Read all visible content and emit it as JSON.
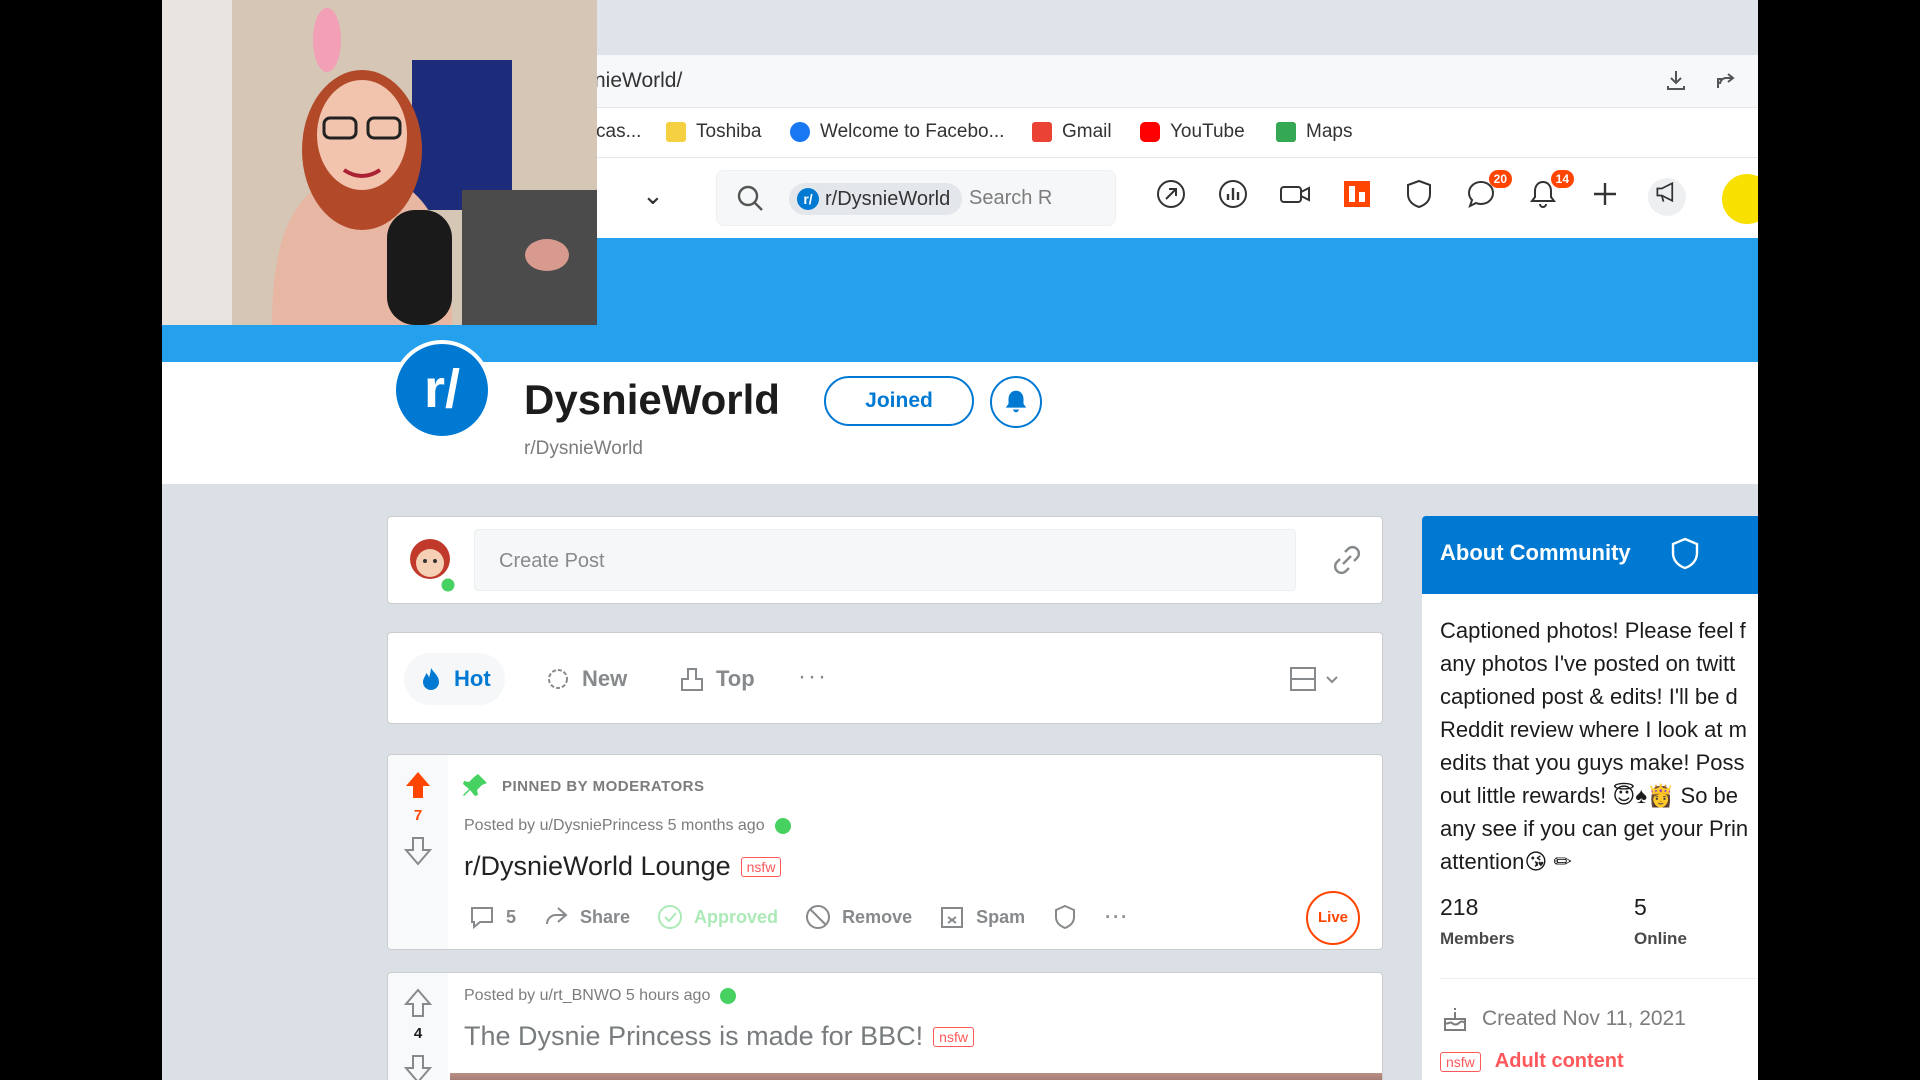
{
  "browser": {
    "url": "nieWorld/",
    "bookmarks": [
      {
        "label": "cas...",
        "color": "#8a8a8a"
      },
      {
        "label": "Toshiba",
        "color": "#f5d142"
      },
      {
        "label": "Welcome to Facebo...",
        "color": "#1877f2"
      },
      {
        "label": "Gmail",
        "color": "#ea4335"
      },
      {
        "label": "YouTube",
        "color": "#ff0000"
      },
      {
        "label": "Maps",
        "color": "#34a853"
      }
    ]
  },
  "header": {
    "search_chip": "r/DysnieWorld",
    "search_placeholder": "Search R",
    "chat_badge": "20",
    "notif_badge": "14"
  },
  "community": {
    "title": "DysnieWorld",
    "name": "r/DysnieWorld",
    "logo_text": "r/",
    "joined_label": "Joined"
  },
  "create_post": {
    "placeholder": "Create Post"
  },
  "sort": {
    "hot": "Hot",
    "new": "New",
    "top": "Top",
    "more": "···"
  },
  "posts": [
    {
      "pinned_label": "PINNED BY MODERATORS",
      "votes": "7",
      "meta": "Posted by u/DysniePrincess 5 months ago",
      "title": "r/DysnieWorld Lounge",
      "tag": "nsfw",
      "comments": "5",
      "share": "Share",
      "approved": "Approved",
      "remove": "Remove",
      "spam": "Spam",
      "more": "···",
      "live": "Live"
    },
    {
      "votes": "4",
      "meta": "Posted by u/rt_BNWO 5 hours ago",
      "title": "The Dysnie Princess is made for BBC!",
      "tag": "nsfw"
    }
  ],
  "about": {
    "title": "About Community",
    "description": "Captioned photos! Please feel f\nany photos I've posted on twitt\ncaptioned post & edits! I'll be d\nReddit review where I look at m\nedits that you guys make! Poss\nout little rewards! 😇♠👸 So be\nany see if you can get your Prin\nattention😘 ✏",
    "members": "218",
    "members_label": "Members",
    "online": "5",
    "online_label": "Online",
    "created": "Created Nov 11, 2021",
    "adult_tag": "nsfw",
    "adult_label": "Adult content"
  },
  "colors": {
    "accent": "#0079d3",
    "banner": "#24a0ed",
    "upvote": "#ff4500",
    "online": "#46d160",
    "nsfw": "#ff585b"
  }
}
